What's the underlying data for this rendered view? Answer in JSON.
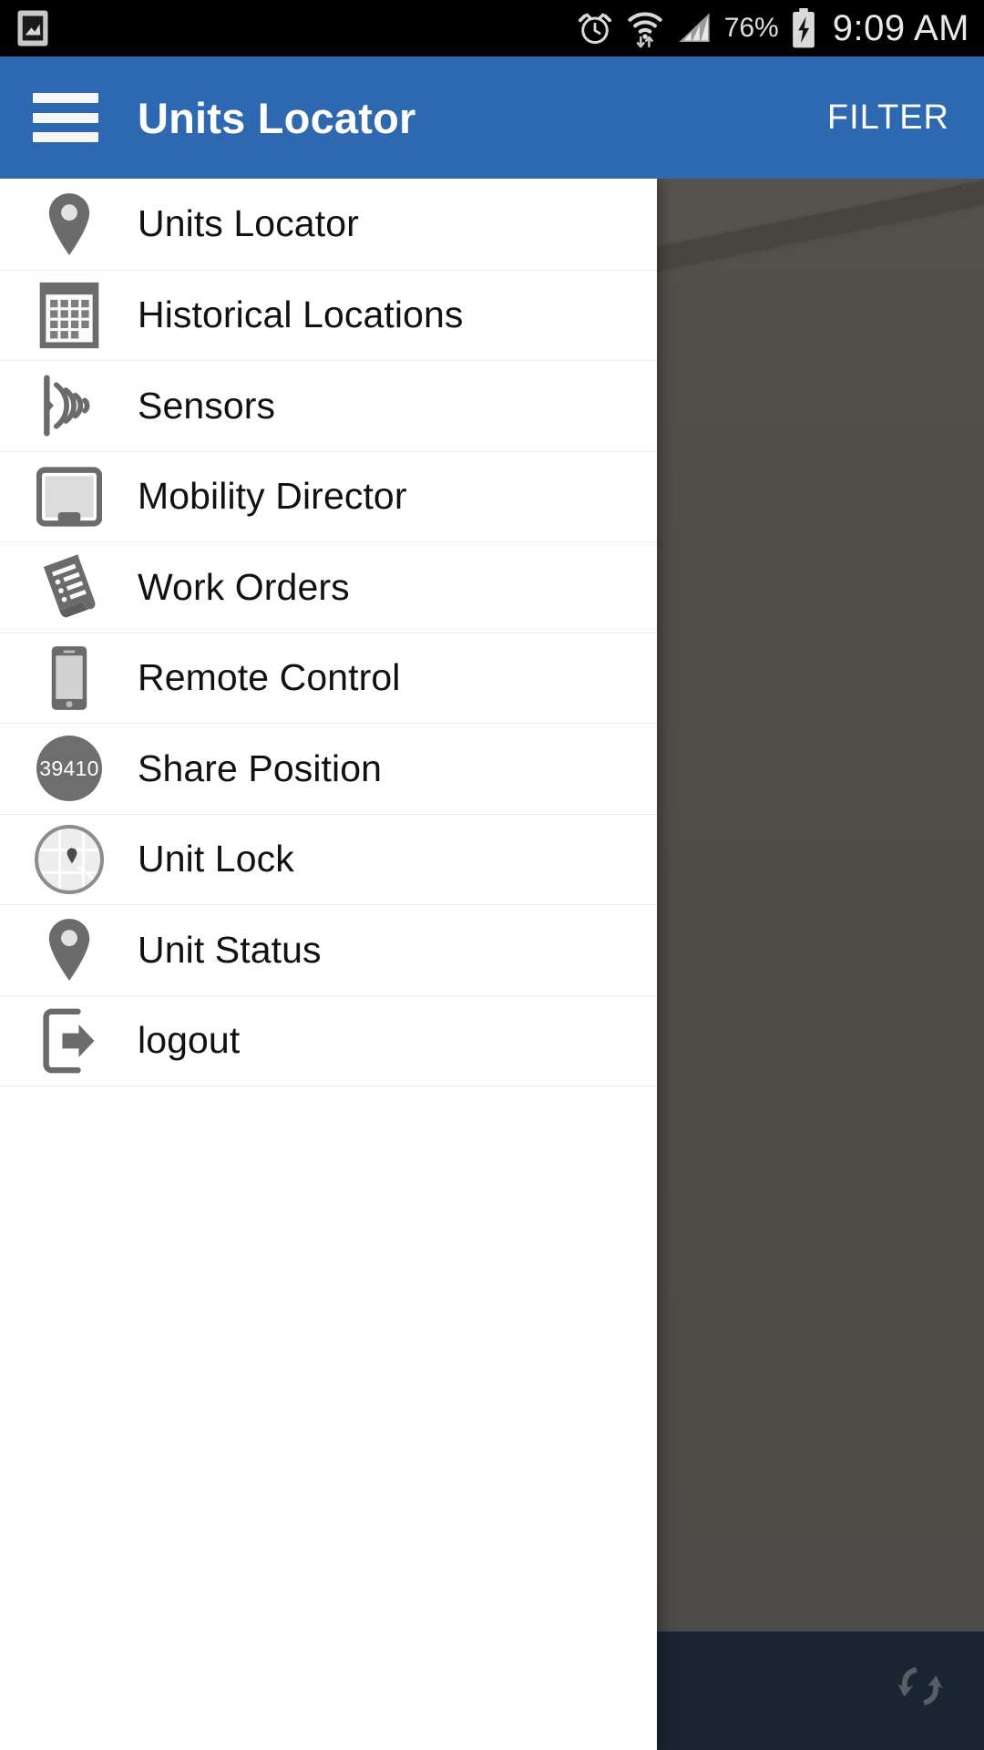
{
  "status_bar": {
    "time": "9:09 AM",
    "battery_percent": "76%",
    "icons": {
      "left": "screenshot-image-icon",
      "alarm": "alarm-clock-icon",
      "wifi": "wifi-transfer-icon",
      "signal": "cellular-signal-icon",
      "battery": "battery-charging-icon"
    }
  },
  "app_bar": {
    "menu_icon": "hamburger-menu-icon",
    "title": "Units Locator",
    "action_label": "FILTER",
    "background_color": "#2e68b0"
  },
  "drawer": {
    "items": [
      {
        "label": "Units Locator",
        "icon": "map-pin-icon"
      },
      {
        "label": "Historical Locations",
        "icon": "calendar-grid-icon"
      },
      {
        "label": "Sensors",
        "icon": "signal-waves-icon"
      },
      {
        "label": "Mobility Director",
        "icon": "tablet-monitor-icon"
      },
      {
        "label": "Work Orders",
        "icon": "document-list-icon"
      },
      {
        "label": "Remote Control",
        "icon": "smartphone-icon"
      },
      {
        "label": "Share Position",
        "icon": "unit-id-badge-icon",
        "badge": "39410"
      },
      {
        "label": "Unit Lock",
        "icon": "map-thumbnail-icon"
      },
      {
        "label": "Unit Status",
        "icon": "map-pin-icon"
      },
      {
        "label": "logout",
        "icon": "logout-exit-icon"
      }
    ]
  },
  "map": {
    "marker_icon": "direction-arrow-marker",
    "bottom_bar_icon": "sync-swap-icon",
    "bottom_bar_color": "#2d3f58"
  }
}
